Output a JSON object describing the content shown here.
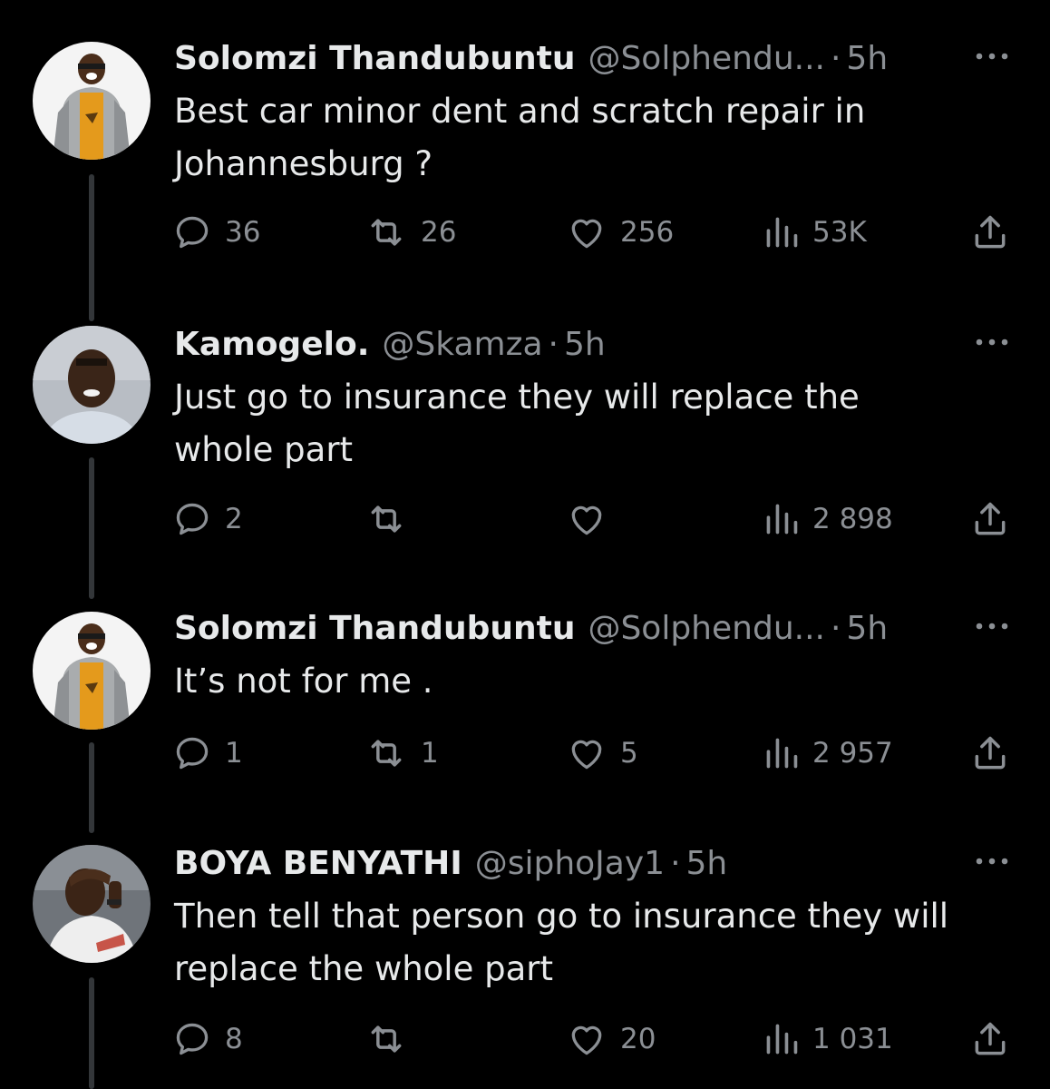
{
  "tweets": [
    {
      "name": "Solomzi Thandubuntu",
      "handle": "@Solphendu...",
      "separator": "·",
      "time": "5h",
      "text_lines": [
        "Best car minor dent and scratch repair in",
        "Johannesburg ?"
      ],
      "replies": "36",
      "retweets": "26",
      "likes": "256",
      "views": "53K",
      "avatar_icon": "person-in-grey-hoodie-avatar"
    },
    {
      "name": "Kamogelo.",
      "handle": "@Skamza",
      "separator": "·",
      "time": "5h",
      "text_lines": [
        "Just go to insurance they will replace the",
        "whole part"
      ],
      "replies": "2",
      "retweets": "",
      "likes": "",
      "views": "2 898",
      "avatar_icon": "person-selfie-avatar"
    },
    {
      "name": "Solomzi Thandubuntu",
      "handle": "@Solphendu...",
      "separator": "·",
      "time": "5h",
      "text_lines": [
        "It’s not for me ."
      ],
      "replies": "1",
      "retweets": "1",
      "likes": "5",
      "views": "2 957",
      "avatar_icon": "person-in-grey-hoodie-avatar"
    },
    {
      "name": "BOYA BENYATHI",
      "handle": "@siphoJay1",
      "separator": "·",
      "time": "5h",
      "text_lines": [
        "Then tell that person go to insurance they will",
        "replace the whole part"
      ],
      "replies": "8",
      "retweets": "",
      "likes": "20",
      "views": "1 031",
      "avatar_icon": "person-in-white-jersey-avatar"
    }
  ],
  "colors": {
    "background": "#000000",
    "primary_text": "#e7e9ea",
    "secondary_text": "#8b8f94",
    "thread_line": "#333639"
  },
  "icons": {
    "reply": "reply-bubble-icon",
    "retweet": "retweet-icon",
    "like": "heart-icon",
    "views": "views-bars-icon",
    "share": "share-upload-icon",
    "more": "more-dots-icon"
  }
}
